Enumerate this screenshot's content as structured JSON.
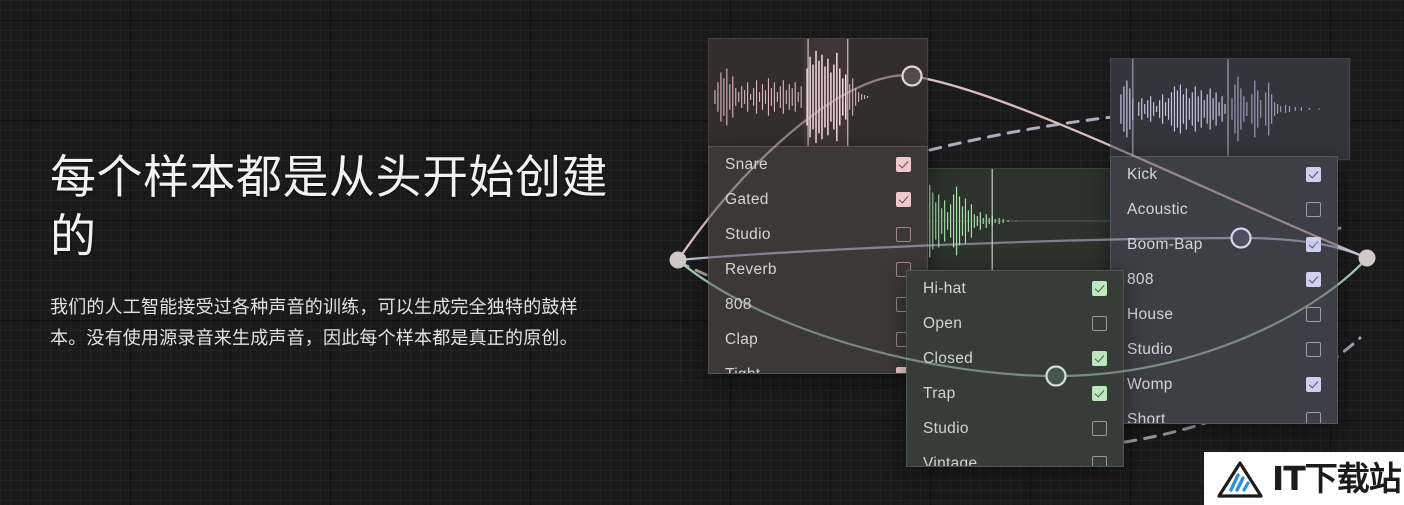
{
  "hero": {
    "headline": "每个样本都是从头开始创建的",
    "subcopy": "我们的人工智能接受过各种声音的训练，可以生成完全独特的鼓样本。没有使用源录音来生成声音，因此每个样本都是真正的原创。"
  },
  "colors": {
    "background": "#1a1a1a",
    "snare_accent": "#e8c4c8",
    "kick_accent": "#c8c8e8",
    "hat_accent": "#a8d4b4",
    "panel_snare_bg": "#3d3838",
    "panel_kick_bg": "#3e3e46",
    "panel_hat_bg": "#383c38"
  },
  "panels": {
    "snare": {
      "name": "snare",
      "items": [
        {
          "label": "Snare",
          "checked": true
        },
        {
          "label": "Gated",
          "checked": true
        },
        {
          "label": "Studio",
          "checked": false
        },
        {
          "label": "Reverb",
          "checked": false
        },
        {
          "label": "808",
          "checked": false
        },
        {
          "label": "Clap",
          "checked": false
        },
        {
          "label": "Tight",
          "checked": true
        }
      ]
    },
    "hihat": {
      "name": "hi-hat",
      "items": [
        {
          "label": "Hi-hat",
          "checked": true
        },
        {
          "label": "Open",
          "checked": false
        },
        {
          "label": "Closed",
          "checked": true
        },
        {
          "label": "Trap",
          "checked": true
        },
        {
          "label": "Studio",
          "checked": false
        },
        {
          "label": "Vintage",
          "checked": false
        }
      ]
    },
    "kick": {
      "name": "kick",
      "items": [
        {
          "label": "Kick",
          "checked": true
        },
        {
          "label": "Acoustic",
          "checked": false
        },
        {
          "label": "Boom-Bap",
          "checked": true
        },
        {
          "label": "808",
          "checked": true
        },
        {
          "label": "House",
          "checked": false
        },
        {
          "label": "Studio",
          "checked": false
        },
        {
          "label": "Womp",
          "checked": true
        },
        {
          "label": "Short",
          "checked": false
        }
      ]
    }
  },
  "waveforms": {
    "snare": {
      "name": "snare-waveform",
      "color": "#e0b9bd"
    },
    "kick": {
      "name": "kick-waveform",
      "color": "#c6c6e4"
    },
    "hihat": {
      "name": "hihat-waveform",
      "color": "#a9e0ae"
    }
  },
  "watermark": {
    "text": "IT下载站",
    "logo_icon": "triangle-logo-icon"
  }
}
